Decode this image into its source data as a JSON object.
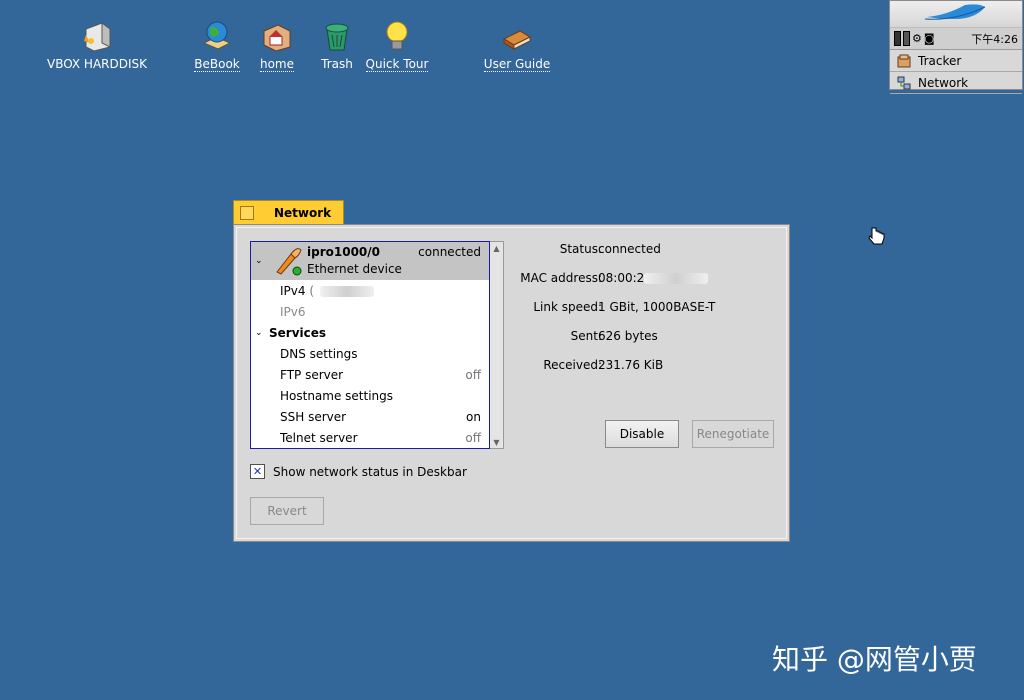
{
  "desktop": {
    "icons": [
      {
        "label": "VBOX HARDDISK",
        "icon": "harddisk-icon"
      },
      {
        "label": "BeBook",
        "icon": "globe-book-icon"
      },
      {
        "label": "home",
        "icon": "home-folder-icon"
      },
      {
        "label": "Trash",
        "icon": "trash-icon"
      },
      {
        "label": "Quick Tour",
        "icon": "lightbulb-icon"
      },
      {
        "label": "User Guide",
        "icon": "book-icon"
      }
    ]
  },
  "deskbar": {
    "clock": "下午4:26",
    "items": [
      {
        "label": "Tracker",
        "icon": "tracker-icon"
      },
      {
        "label": "Network",
        "icon": "network-icon"
      }
    ]
  },
  "window": {
    "title": "Network",
    "device": {
      "name": "ipro1000/0",
      "type": "Ethernet device",
      "status": "connected"
    },
    "list": {
      "ipv4": "IPv4",
      "ipv6": "IPv6",
      "services_header": "Services",
      "services": [
        {
          "name": "DNS settings",
          "value": ""
        },
        {
          "name": "FTP server",
          "value": "off"
        },
        {
          "name": "Hostname settings",
          "value": ""
        },
        {
          "name": "SSH server",
          "value": "on"
        },
        {
          "name": "Telnet server",
          "value": "off"
        }
      ]
    },
    "info": {
      "status_label": "Status:",
      "status_value": "connected",
      "mac_label": "MAC address:",
      "mac_value": "08:00:2",
      "link_label": "Link speed:",
      "link_value": "1 GBit, 1000BASE-T",
      "sent_label": "Sent:",
      "sent_value": "626 bytes",
      "received_label": "Received:",
      "received_value": "231.76 KiB"
    },
    "buttons": {
      "disable": "Disable",
      "renegotiate": "Renegotiate",
      "revert": "Revert"
    },
    "checkbox_label": "Show network status in Deskbar"
  },
  "watermark": "知乎 @网管小贾",
  "colors": {
    "desktop_bg": "#336699",
    "tab_yellow": "#ffcc33",
    "window_bg": "#d8d8d8",
    "selection": "#c4c4c4",
    "list_border": "#1b1ba0"
  }
}
